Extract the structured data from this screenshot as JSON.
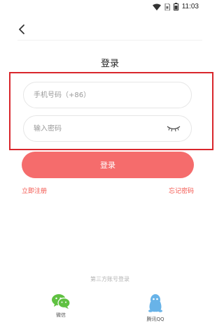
{
  "status_bar": {
    "time": "11:03"
  },
  "page": {
    "title": "登录"
  },
  "form": {
    "phone_placeholder": "手机号码（+86）",
    "password_placeholder": "输入密码",
    "login_label": "登录",
    "register_label": "立即注册",
    "forgot_label": "忘记密码"
  },
  "third_party": {
    "title": "第三方账号登录",
    "options": [
      {
        "label": "微信",
        "icon": "wechat-icon"
      },
      {
        "label": "腾讯QQ",
        "icon": "qq-icon"
      }
    ]
  },
  "colors": {
    "accent": "#f56c6c",
    "link": "#f3554d",
    "highlight_border": "#d9262c",
    "wechat": "#5fc141",
    "qq": "#68b3e8"
  }
}
